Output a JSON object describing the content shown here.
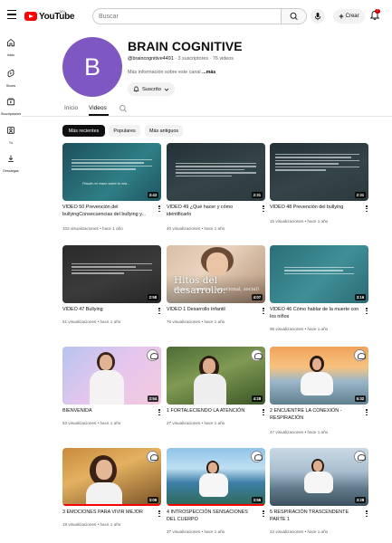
{
  "header": {
    "logo_text": "YouTube",
    "logo_cc": "MX",
    "search_placeholder": "Buscar",
    "create_label": "Crear",
    "notification_count": "7"
  },
  "sidebar": {
    "items": [
      {
        "label": "Inicio",
        "icon": "home-icon"
      },
      {
        "label": "Shorts",
        "icon": "shorts-icon"
      },
      {
        "label": "Suscripciones",
        "icon": "subscriptions-icon"
      },
      {
        "label": "Tú",
        "icon": "you-icon"
      },
      {
        "label": "Descargas",
        "icon": "download-icon"
      }
    ]
  },
  "channel": {
    "avatar_letter": "B",
    "avatar_color": "#7e57c2",
    "name": "BRAIN COGNITIVE",
    "handle": "@braincognitive4491",
    "stats": " · 3 suscriptores · 76 videos",
    "description": "Más información sobre este canal ",
    "more": "...más",
    "subscribed_label": "Suscrito"
  },
  "tabs": [
    {
      "label": "Inicio",
      "active": false
    },
    {
      "label": "Videos",
      "active": true
    }
  ],
  "chips": [
    {
      "label": "Más recientes",
      "active": true
    },
    {
      "label": "Populares",
      "active": false
    },
    {
      "label": "Más antiguos",
      "active": false
    }
  ],
  "videos": [
    {
      "title": "VIDEO 50 Prevención del bullyingConsecuencias del bullying y...",
      "views": "102 visualizaciones",
      "age": "hace 1 año",
      "duration": "3:43",
      "thumb_overlay": "Pásale mi mano sobre la mía..."
    },
    {
      "title": "VIDEO 49 ¿Qué hacer y cómo identificarlo",
      "views": "40 visualizaciones",
      "age": "hace 1 año",
      "duration": "2:31"
    },
    {
      "title": "VIDEO 48 Prevención del bullying",
      "views": "15 visualizaciones",
      "age": "hace 1 año",
      "duration": "2:31"
    },
    {
      "title": "VIDEO 47 Bullying",
      "views": "61 visualizaciones",
      "age": "hace 1 año",
      "duration": "2:58"
    },
    {
      "title": "VIDEO 1 Desarrollo Infantil",
      "views": "76 visualizaciones",
      "age": "hace 1 año",
      "duration": "4:07",
      "thumb_overlay": "Hitos del desarrollo:",
      "thumb_sub": "(físico, cognitivo, emocional, social)"
    },
    {
      "title": "VIDEO 46 Cómo hablar de la muerte con los niños",
      "views": "95 visualizaciones",
      "age": "hace 1 año",
      "duration": "3:16"
    },
    {
      "title": "BIENVENIDA",
      "views": "53 visualizaciones",
      "age": "hace 1 año",
      "duration": "2:54"
    },
    {
      "title": "1 FORTALECIENDO LA ATENCIÓN",
      "views": "27 visualizaciones",
      "age": "hace 1 año",
      "duration": "4:28"
    },
    {
      "title": "2 ENCUENTRE LA CONEXIÓN - RESPIRACIÓN",
      "views": "47 visualizaciones",
      "age": "hace 1 año",
      "duration": "5:32"
    },
    {
      "title": "3 EMOCIONES PARA VIVIR MEJOR",
      "views": "19 visualizaciones",
      "age": "hace 1 año",
      "duration": "3:09"
    },
    {
      "title": "4 INTROSPECCIÓN SENSACIONES DEL CUERPO",
      "views": "37 visualizaciones",
      "age": "hace 1 año",
      "duration": "3:56"
    },
    {
      "title": "5 RESPIRACIÓN TRASCENDENTE PARTE 1",
      "views": "24 visualizaciones",
      "age": "hace 1 año",
      "duration": "3:28"
    }
  ],
  "separator": " • "
}
